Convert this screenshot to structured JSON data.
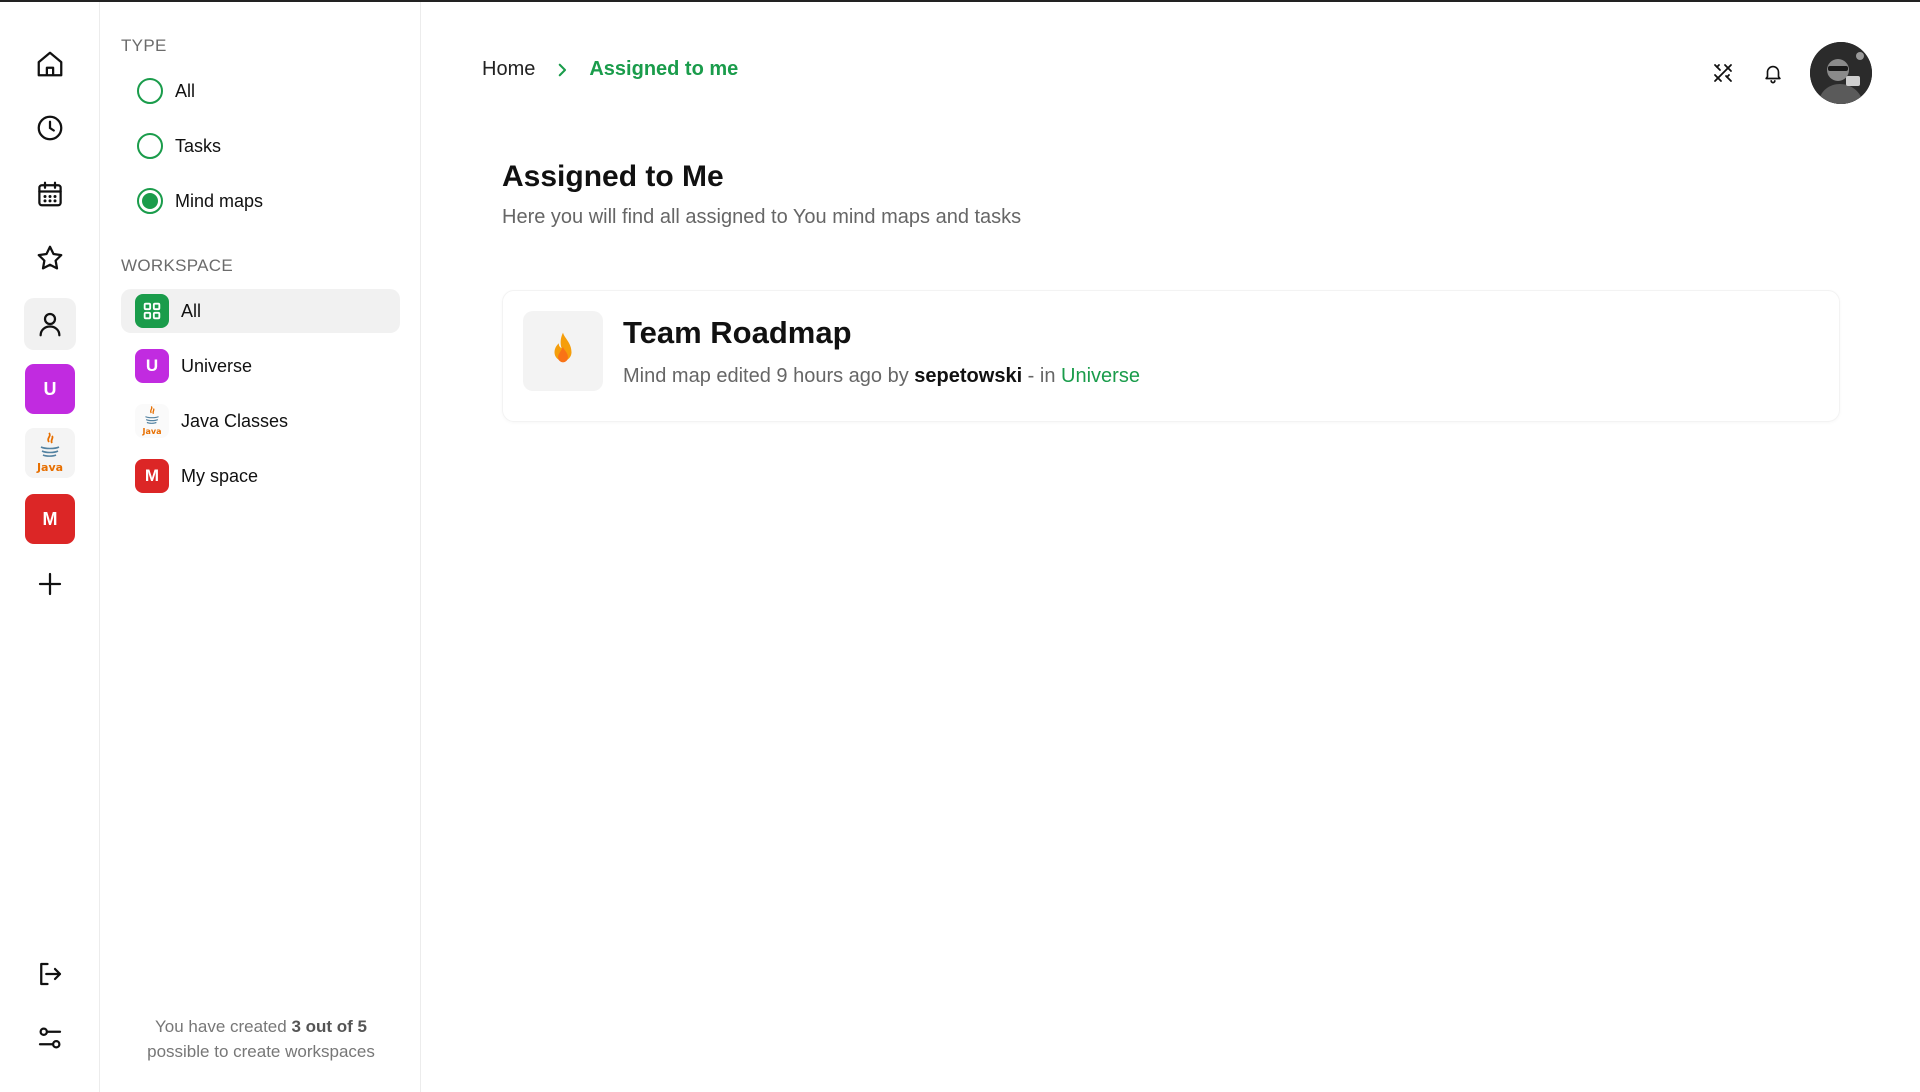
{
  "rail": {
    "workspaces": [
      {
        "letter": "U",
        "color": "#c12be0"
      },
      {
        "letter": "",
        "logo_text": "Java"
      },
      {
        "letter": "M",
        "color": "#dc2626"
      }
    ]
  },
  "filters": {
    "type_label": "TYPE",
    "types": [
      {
        "label": "All",
        "selected": false
      },
      {
        "label": "Tasks",
        "selected": false
      },
      {
        "label": "Mind maps",
        "selected": true
      }
    ],
    "workspace_label": "WORKSPACE",
    "workspaces": [
      {
        "label": "All",
        "selected": true,
        "color": "#1a9c4b"
      },
      {
        "label": "Universe",
        "badge": "U",
        "color": "#c12be0"
      },
      {
        "label": "Java Classes",
        "logo_text": "Java"
      },
      {
        "label": "My space",
        "badge": "M",
        "color": "#dc2626"
      }
    ],
    "quota_prefix": "You have created ",
    "quota_count": "3 out of 5",
    "quota_suffix": "possible to create workspaces"
  },
  "breadcrumb": {
    "home": "Home",
    "current": "Assigned to me"
  },
  "page": {
    "title": "Assigned to Me",
    "subtitle": "Here you will find all assigned to You mind maps and tasks"
  },
  "items": [
    {
      "title": "Team Roadmap",
      "meta_prefix": "Mind map edited 9 hours ago by ",
      "author": "sepetowski",
      "meta_mid": " - in ",
      "workspace": "Universe"
    }
  ],
  "colors": {
    "accent": "#1a9c4b",
    "universe": "#c12be0",
    "myspace": "#dc2626"
  }
}
